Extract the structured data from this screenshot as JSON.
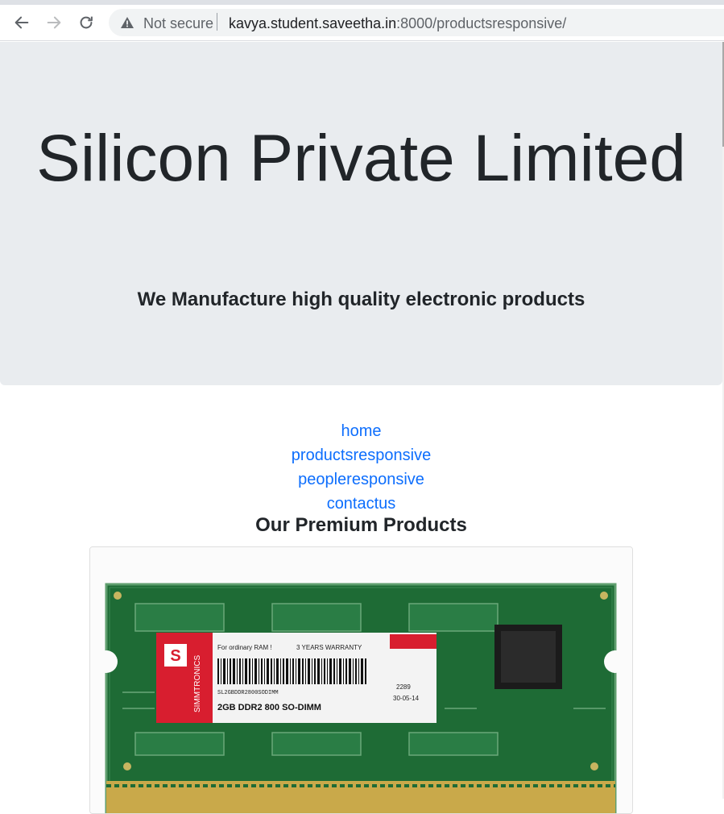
{
  "browser": {
    "security_label": "Not secure",
    "url_host": "kavya.student.saveetha.in",
    "url_rest": ":8000/productsresponsive/",
    "icons": [
      "back-icon",
      "forward-icon",
      "reload-icon",
      "warning-icon"
    ]
  },
  "jumbotron": {
    "title": "Silicon Private Limited",
    "subtitle": "We Manufacture high quality electronic products"
  },
  "nav": {
    "links": [
      {
        "label": "home"
      },
      {
        "label": "productsresponsive"
      },
      {
        "label": "peopleresponsive"
      },
      {
        "label": "contactus"
      }
    ]
  },
  "products": {
    "heading": "Our Premium Products",
    "card_image": {
      "brand_logo": "S",
      "brand_name": "SIMMTRONICS",
      "label_line1": "For ordinary RAM !",
      "label_line2": "3 YEARS WARRANTY",
      "label_serial": "SL2GBDDR2800SODIMM",
      "label_model": "2GB DDR2 800 SO-DIMM",
      "label_date": "2289",
      "label_date2": "30-05-14"
    }
  },
  "colors": {
    "jumbotron_bg": "#e9ecef",
    "link": "#0d6efd",
    "text": "#212529",
    "pcb_green": "#1e6b35"
  }
}
